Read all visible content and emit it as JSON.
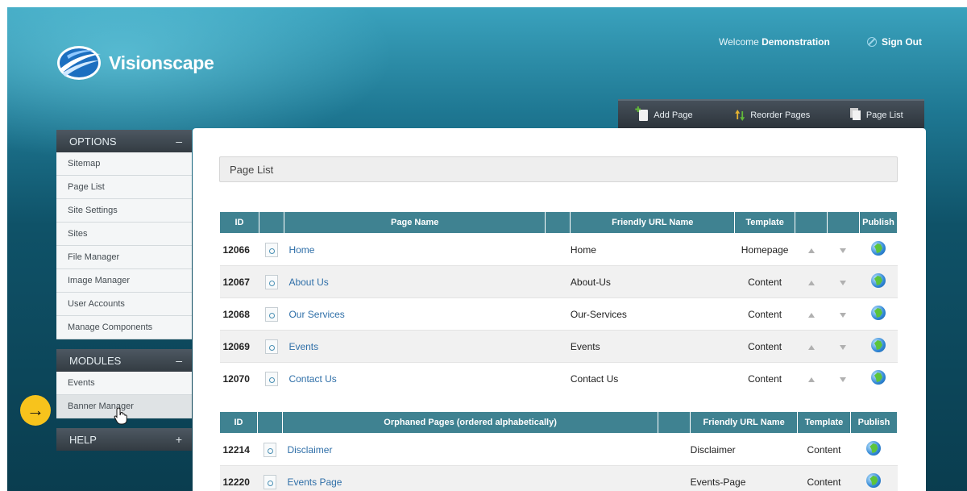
{
  "header": {
    "brand": "Visionscape",
    "welcome_prefix": "Welcome",
    "user_name": "Demonstration",
    "sign_out": "Sign Out"
  },
  "toolbar": {
    "add_page": "Add Page",
    "reorder_pages": "Reorder Pages",
    "page_list": "Page List"
  },
  "sidebar": {
    "options": {
      "title": "OPTIONS",
      "toggle": "–",
      "items": [
        "Sitemap",
        "Page List",
        "Site Settings",
        "Sites",
        "File Manager",
        "Image Manager",
        "User Accounts",
        "Manage Components"
      ]
    },
    "modules": {
      "title": "MODULES",
      "toggle": "–",
      "items": [
        "Events",
        "Banner Manager"
      ]
    },
    "help": {
      "title": "HELP",
      "toggle": "+"
    }
  },
  "callout_arrow": "→",
  "main": {
    "breadcrumb": "Page List",
    "pages_table": {
      "headers": {
        "id": "ID",
        "page_name": "Page Name",
        "friendly_url": "Friendly URL Name",
        "template": "Template",
        "publish": "Publish"
      },
      "rows": [
        {
          "id": "12066",
          "name": "Home",
          "url": "Home",
          "template": "Homepage"
        },
        {
          "id": "12067",
          "name": "About Us",
          "url": "About-Us",
          "template": "Content"
        },
        {
          "id": "12068",
          "name": "Our Services",
          "url": "Our-Services",
          "template": "Content"
        },
        {
          "id": "12069",
          "name": "Events",
          "url": "Events",
          "template": "Content"
        },
        {
          "id": "12070",
          "name": "Contact Us",
          "url": "Contact Us",
          "template": "Content"
        }
      ]
    },
    "orphan_table": {
      "headers": {
        "id": "ID",
        "page_name": "Orphaned Pages (ordered alphabetically)",
        "friendly_url": "Friendly URL Name",
        "template": "Template",
        "publish": "Publish"
      },
      "rows": [
        {
          "id": "12214",
          "name": "Disclaimer",
          "url": "Disclaimer",
          "template": "Content"
        },
        {
          "id": "12220",
          "name": "Events Page",
          "url": "Events-Page",
          "template": "Content"
        }
      ]
    }
  }
}
